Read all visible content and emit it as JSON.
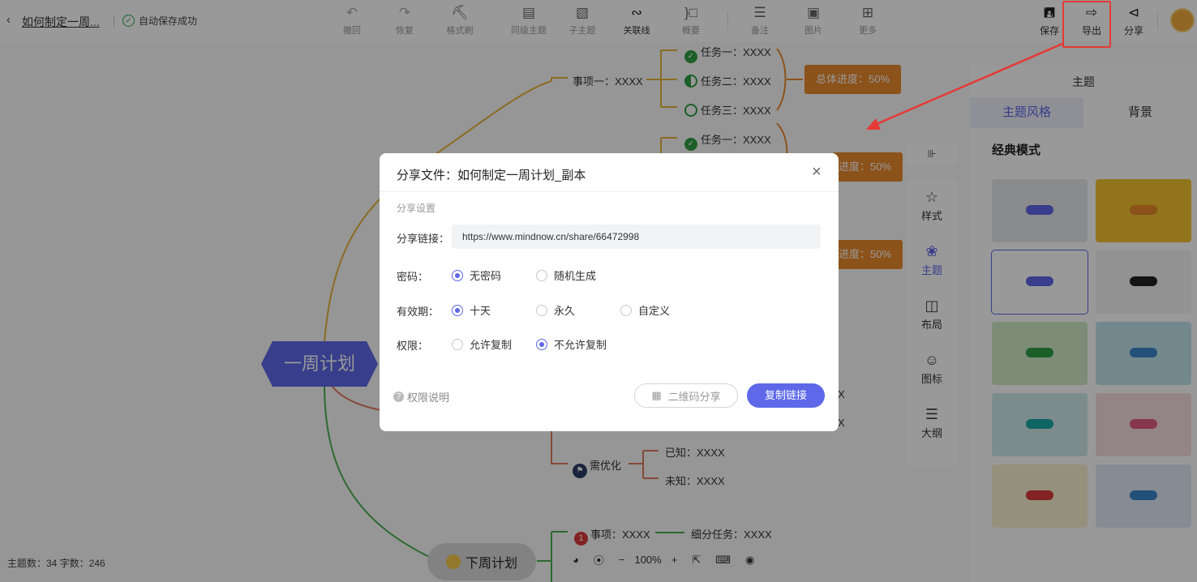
{
  "header": {
    "back_icon": "chevron-left-icon",
    "doc_title": "如何制定一周...",
    "autosave": "自动保存成功",
    "tools": [
      {
        "label": "撤回",
        "icon": "undo-icon"
      },
      {
        "label": "恢复",
        "icon": "redo-icon"
      },
      {
        "label": "格式刷",
        "icon": "format-brush-icon"
      },
      {
        "label": "同级主题",
        "icon": "sibling-topic-icon"
      },
      {
        "label": "子主题",
        "icon": "child-topic-icon"
      },
      {
        "label": "关联线",
        "icon": "relation-line-icon"
      },
      {
        "label": "概要",
        "icon": "summary-icon"
      },
      {
        "label": "备注",
        "icon": "note-icon"
      },
      {
        "label": "图片",
        "icon": "image-icon"
      },
      {
        "label": "更多",
        "icon": "more-icon"
      }
    ],
    "save_label": "保存",
    "export_label": "导出",
    "share_label": "分享"
  },
  "canvas": {
    "nodes": {
      "item1": "事项一：XXXX",
      "task1": "任务一：XXXX",
      "task2": "任务二：XXXX",
      "task3": "任务三：XXXX",
      "task1b": "任务一：XXXX",
      "progress1": "总体进度：50%",
      "progress2": "进度：50%",
      "progress3": "进度：50%",
      "central": "一周计划",
      "needs_opt": "需优化",
      "known": "已知：XXXX",
      "unknown": "未知：XXXX",
      "next_item": "事项：XXXX",
      "next_item_badge": "1",
      "subtask": "细分任务：XXXX",
      "next_week": "下周计划",
      "cut_x1": "X",
      "cut_x2": "X"
    },
    "status": "主题数：34  字数：246",
    "zoom": "100%",
    "zoom_minus": "−",
    "zoom_plus": "+"
  },
  "sidetools": {
    "collapse": "⊪",
    "items": [
      {
        "label": "样式",
        "icon": "style-icon"
      },
      {
        "label": "主题",
        "icon": "theme-palette-icon"
      },
      {
        "label": "布局",
        "icon": "layout-icon"
      },
      {
        "label": "图标",
        "icon": "emoji-icon"
      },
      {
        "label": "大纲",
        "icon": "outline-icon"
      }
    ]
  },
  "theme_panel": {
    "title": "主题",
    "tabs": [
      "主题风格",
      "背景"
    ],
    "section": "经典模式",
    "thumb_colors": [
      "#e6e8ec",
      "#f2c230",
      "#ffffff",
      "#f4f4f4",
      "#cfe9c7",
      "#bfe3ec",
      "#cfeaea",
      "#f5dce3",
      "#f7f0cf",
      "#dfe9f5"
    ],
    "thumb_center_colors": [
      "#5e68e8",
      "#e8892c",
      "#5e68e8",
      "#222222",
      "#2f9e44",
      "#3a86c8",
      "#19a7a7",
      "#e05d7f",
      "#d93a3a",
      "#3a86c8"
    ]
  },
  "dialog": {
    "title": "分享文件：如何制定一周计划_副本",
    "section": "分享设置",
    "link_label": "分享链接：",
    "link_value": "https://www.mindnow.cn/share/66472998",
    "password_label": "密码：",
    "password_options": [
      "无密码",
      "随机生成"
    ],
    "validity_label": "有效期：",
    "validity_options": [
      "十天",
      "永久",
      "自定义"
    ],
    "permission_label": "权限：",
    "permission_options": [
      "允许复制",
      "不允许复制"
    ],
    "help": "权限说明",
    "qr_button": "二维码分享",
    "copy_button": "复制链接"
  },
  "colors": {
    "accent": "#5e68e8",
    "progress": "#e8892c",
    "highlight": "#e53935"
  }
}
